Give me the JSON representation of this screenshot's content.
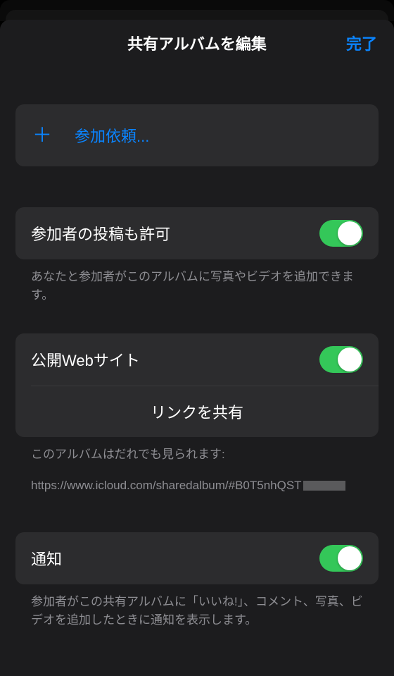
{
  "header": {
    "title": "共有アルバムを編集",
    "done": "完了"
  },
  "invite": {
    "label": "参加依頼..."
  },
  "subscriberPosting": {
    "label": "参加者の投稿も許可",
    "footer": "あなたと参加者がこのアルバムに写真やビデオを追加できます。",
    "enabled": true
  },
  "publicWebsite": {
    "label": "公開Webサイト",
    "shareLink": "リンクを共有",
    "footer1": "このアルバムはだれでも見られます:",
    "url": "https://www.icloud.com/sharedalbum/#B0T5nhQST",
    "enabled": true
  },
  "notifications": {
    "label": "通知",
    "footer": "参加者がこの共有アルバムに「いいね!」、コメント、写真、ビデオを追加したときに通知を表示します。",
    "enabled": true
  }
}
